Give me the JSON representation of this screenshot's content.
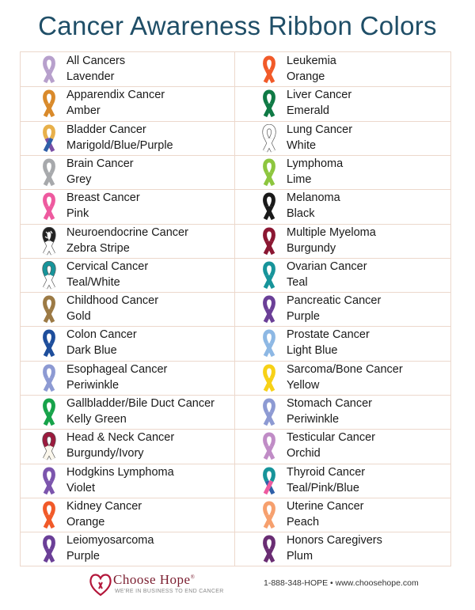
{
  "title": "Cancer Awareness Ribbon Colors",
  "left_column": [
    {
      "name": "All Cancers",
      "color_name": "Lavender",
      "colors": [
        "#b7a0cc"
      ]
    },
    {
      "name": "Apparendix Cancer",
      "color_name": "Amber",
      "colors": [
        "#d98a2b"
      ]
    },
    {
      "name": "Bladder Cancer",
      "color_name": "Marigold/Blue/Purple",
      "colors": [
        "#e8b04a",
        "#2f5fa8",
        "#7b4fa5"
      ]
    },
    {
      "name": "Brain Cancer",
      "color_name": "Grey",
      "colors": [
        "#a7a9ac"
      ]
    },
    {
      "name": "Breast Cancer",
      "color_name": "Pink",
      "colors": [
        "#ee5a9f"
      ]
    },
    {
      "name": "Neuroendocrine Cancer",
      "color_name": "Zebra Stripe",
      "colors": [
        "#222222",
        "#ffffff"
      ]
    },
    {
      "name": "Cervical Cancer",
      "color_name": "Teal/White",
      "colors": [
        "#17949a",
        "#ffffff"
      ]
    },
    {
      "name": "Childhood Cancer",
      "color_name": "Gold",
      "colors": [
        "#9c7a45"
      ]
    },
    {
      "name": "Colon Cancer",
      "color_name": "Dark Blue",
      "colors": [
        "#1e4e9c"
      ]
    },
    {
      "name": "Esophageal Cancer",
      "color_name": "Periwinkle",
      "colors": [
        "#8d9ad3"
      ]
    },
    {
      "name": "Gallbladder/Bile Duct Cancer",
      "color_name": "Kelly Green",
      "colors": [
        "#17a34a"
      ]
    },
    {
      "name": "Head & Neck Cancer",
      "color_name": "Burgundy/Ivory",
      "colors": [
        "#9b1b3e",
        "#fbf7ec"
      ]
    },
    {
      "name": "Hodgkins Lymphoma",
      "color_name": "Violet",
      "colors": [
        "#7c55ad"
      ]
    },
    {
      "name": "Kidney Cancer",
      "color_name": "Orange",
      "colors": [
        "#f15a29"
      ]
    },
    {
      "name": "Leiomyosarcoma",
      "color_name": "Purple",
      "colors": [
        "#6b3f97"
      ]
    }
  ],
  "right_column": [
    {
      "name": "Leukemia",
      "color_name": "Orange",
      "colors": [
        "#f15a29"
      ]
    },
    {
      "name": "Liver Cancer",
      "color_name": "Emerald",
      "colors": [
        "#0f7a45"
      ]
    },
    {
      "name": "Lung Cancer",
      "color_name": "White",
      "colors": [
        "#ffffff"
      ]
    },
    {
      "name": "Lymphoma",
      "color_name": "Lime",
      "colors": [
        "#8dc63f"
      ]
    },
    {
      "name": "Melanoma",
      "color_name": "Black",
      "colors": [
        "#1a1a1a"
      ]
    },
    {
      "name": "Multiple Myeloma",
      "color_name": "Burgundy",
      "colors": [
        "#8b1732"
      ]
    },
    {
      "name": "Ovarian Cancer",
      "color_name": "Teal",
      "colors": [
        "#17949a"
      ]
    },
    {
      "name": "Pancreatic Cancer",
      "color_name": "Purple",
      "colors": [
        "#6b3f97"
      ]
    },
    {
      "name": "Prostate Cancer",
      "color_name": "Light Blue",
      "colors": [
        "#8db8e4"
      ]
    },
    {
      "name": "Sarcoma/Bone Cancer",
      "color_name": "Yellow",
      "colors": [
        "#f7d117"
      ]
    },
    {
      "name": "Stomach Cancer",
      "color_name": "Periwinkle",
      "colors": [
        "#8d9ad3"
      ]
    },
    {
      "name": "Testicular Cancer",
      "color_name": "Orchid",
      "colors": [
        "#c08cc6"
      ]
    },
    {
      "name": "Thyroid Cancer",
      "color_name": "Teal/Pink/Blue",
      "colors": [
        "#17949a",
        "#ee5a9f",
        "#2f5fa8"
      ]
    },
    {
      "name": "Uterine Cancer",
      "color_name": "Peach",
      "colors": [
        "#f6a06e"
      ]
    },
    {
      "name": "Honors Caregivers",
      "color_name": "Plum",
      "colors": [
        "#6a2d73"
      ]
    }
  ],
  "footer": {
    "logo_text": "Choose Hope",
    "logo_reg": "®",
    "tagline": "WE'RE IN BUSINESS TO END CANCER",
    "contact": "1-888-348-HOPE • www.choosehope.com",
    "heart_color": "#b3163a"
  }
}
